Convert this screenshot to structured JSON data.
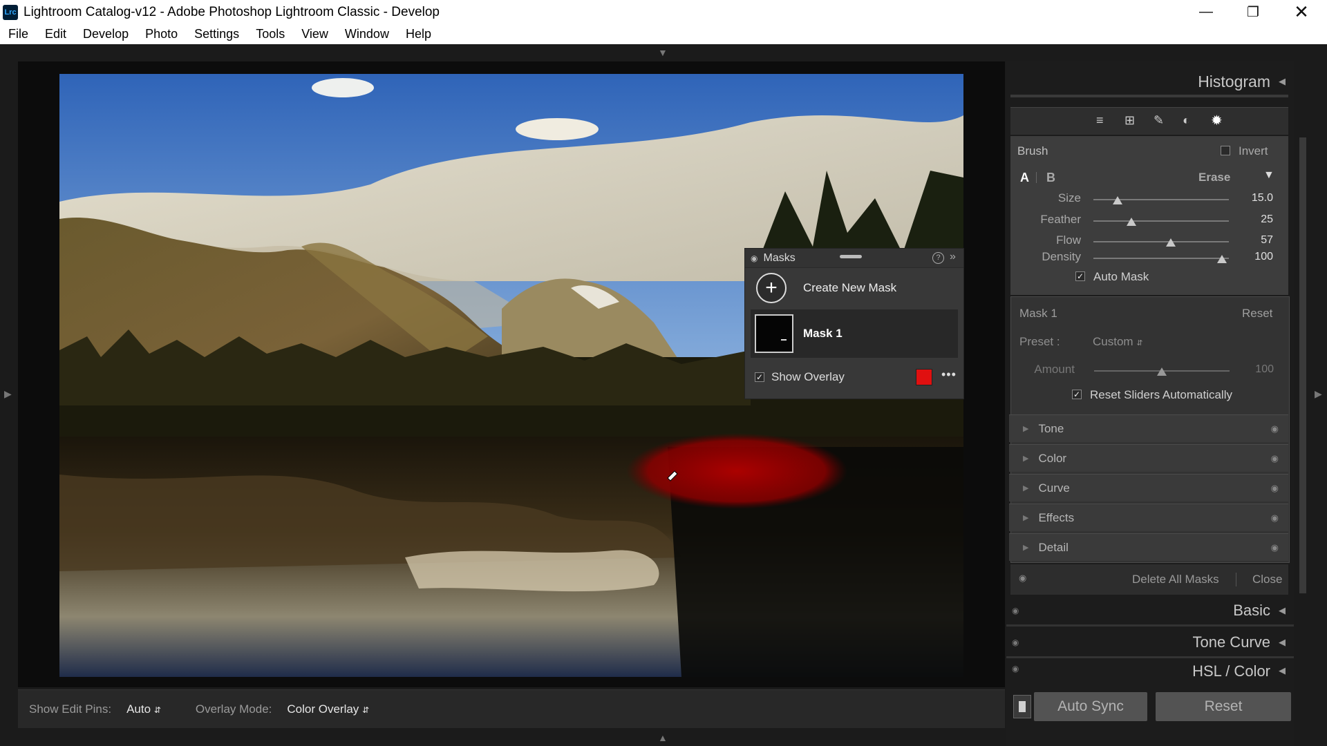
{
  "window": {
    "app_icon": "Lrc",
    "title": "Lightroom Catalog-v12 - Adobe Photoshop Lightroom Classic - Develop",
    "controls": [
      "minimize-icon",
      "restore-icon",
      "close-icon"
    ]
  },
  "menu": [
    "File",
    "Edit",
    "Develop",
    "Photo",
    "Settings",
    "Tools",
    "View",
    "Window",
    "Help"
  ],
  "masks_panel": {
    "title": "Masks",
    "create_label": "Create New Mask",
    "mask_name": "Mask 1",
    "show_overlay_label": "Show Overlay",
    "show_overlay_checked": true,
    "overlay_color": "#e01010"
  },
  "toolbar": {
    "pins_label": "Show Edit Pins:",
    "pins_value": "Auto",
    "overlay_mode_label": "Overlay Mode:",
    "overlay_mode_value": "Color Overlay"
  },
  "right_panel": {
    "histogram_title": "Histogram",
    "tool_icons": [
      "edit-sliders-icon",
      "crop-icon",
      "healing-brush-icon",
      "red-eye-icon",
      "masking-icon"
    ],
    "brush": {
      "title": "Brush",
      "invert_label": "Invert",
      "tab_a": "A",
      "tab_b": "B",
      "erase_label": "Erase",
      "sliders": [
        {
          "label": "Size",
          "value": "15.0",
          "fraction": 0.18
        },
        {
          "label": "Feather",
          "value": "25",
          "fraction": 0.28
        },
        {
          "label": "Flow",
          "value": "57",
          "fraction": 0.57
        },
        {
          "label": "Density",
          "value": "100",
          "fraction": 0.95
        }
      ],
      "auto_mask_label": "Auto Mask",
      "auto_mask_checked": true
    },
    "mask_settings": {
      "title": "Mask 1",
      "reset_label": "Reset",
      "preset_label": "Preset :",
      "preset_value": "Custom",
      "amount_label": "Amount",
      "amount_value": "100",
      "amount_fraction": 0.5,
      "reset_sliders_label": "Reset Sliders Automatically"
    },
    "sections": [
      "Tone",
      "Color",
      "Curve",
      "Effects",
      "Detail"
    ],
    "delete_all_label": "Delete All Masks",
    "close_label": "Close",
    "panels": [
      "Basic",
      "Tone Curve",
      "HSL / Color"
    ],
    "auto_sync_label": "Auto Sync",
    "reset_label": "Reset"
  }
}
